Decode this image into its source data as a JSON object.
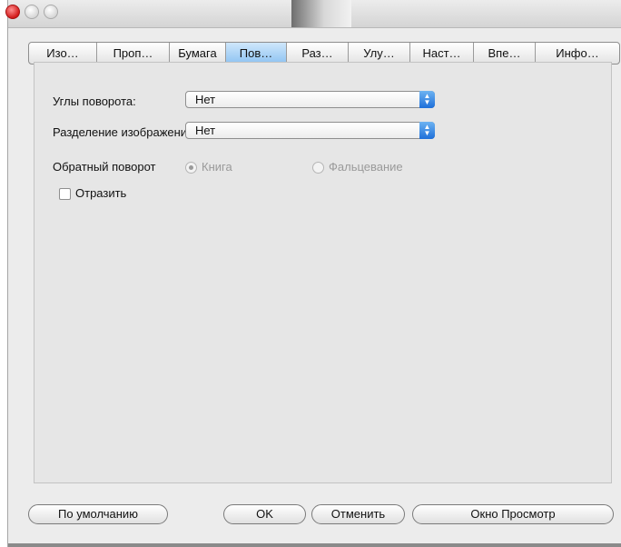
{
  "tabs": [
    {
      "label": "Изо…"
    },
    {
      "label": "Проп…"
    },
    {
      "label": "Бумага"
    },
    {
      "label": "Пов…"
    },
    {
      "label": "Раз…"
    },
    {
      "label": "Улу…"
    },
    {
      "label": "Наст…"
    },
    {
      "label": "Впе…"
    },
    {
      "label": "Инфо…"
    }
  ],
  "active_tab": "Пов…",
  "form": {
    "rotation_label": "Углы поворота:",
    "rotation_value": "Нет",
    "split_label": "Разделение изображения",
    "split_value": "Нет",
    "reverse_label": "Обратный поворот",
    "reverse_options": [
      "Книга",
      "Фальцевание"
    ],
    "reverse_selected": "Книга",
    "mirror_label": "Отразить",
    "mirror_checked": false
  },
  "buttons": {
    "defaults": "По умолчанию",
    "ok": "OK",
    "cancel": "Отменить",
    "preview": "Окно Просмотр"
  }
}
